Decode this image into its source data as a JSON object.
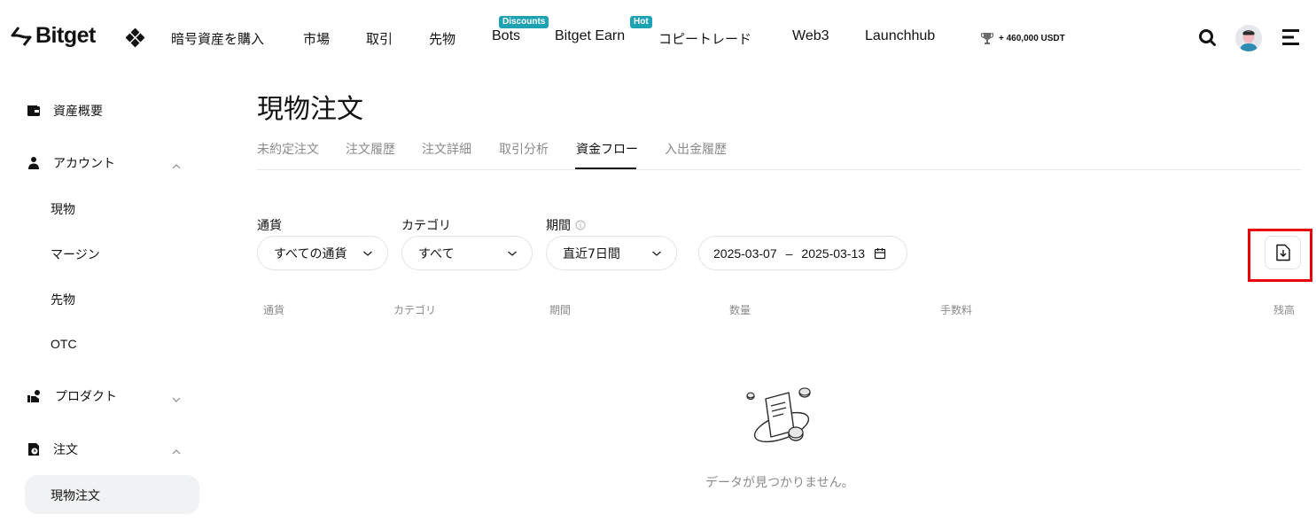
{
  "nav": {
    "logo": "Bitget",
    "items": [
      {
        "label": "暗号資産を購入"
      },
      {
        "label": "市場"
      },
      {
        "label": "取引"
      },
      {
        "label": "先物"
      },
      {
        "label": "Bots",
        "badge": "Discounts"
      },
      {
        "label": "Bitget Earn",
        "badge": "Hot"
      },
      {
        "label": "コピートレード"
      },
      {
        "label": "Web3"
      },
      {
        "label": "Launchhub"
      }
    ],
    "prize": "+ 460,000 USDT",
    "badge_color": "#1da2b4"
  },
  "sidebar": {
    "items": [
      {
        "label": "資産概要",
        "icon": "wallet-icon"
      },
      {
        "label": "アカウント",
        "icon": "account-icon",
        "expanded": true
      },
      {
        "label": "現物"
      },
      {
        "label": "マージン"
      },
      {
        "label": "先物"
      },
      {
        "label": "OTC"
      },
      {
        "label": "プロダクト",
        "icon": "product-icon",
        "expanded": false
      },
      {
        "label": "注文",
        "icon": "order-icon",
        "expanded": true
      },
      {
        "label": "現物注文",
        "active": true
      }
    ]
  },
  "main": {
    "title": "現物注文",
    "tabs": [
      "未約定注文",
      "注文履歴",
      "注文詳細",
      "取引分析",
      "資金フロー",
      "入出金履歴"
    ],
    "active_tab": "資金フロー",
    "filters": {
      "currency_label": "通貨",
      "currency_value": "すべての通貨",
      "category_label": "カテゴリ",
      "category_value": "すべて",
      "period_label": "期間",
      "period_value": "直近7日間",
      "date_start": "2025-03-07",
      "date_sep": "–",
      "date_end": "2025-03-13"
    },
    "table_headers": [
      "通貨",
      "カテゴリ",
      "期間",
      "数量",
      "手数料",
      "残高"
    ],
    "empty_text": "データが見つかりません。",
    "highlight_color": "#e8000b"
  }
}
